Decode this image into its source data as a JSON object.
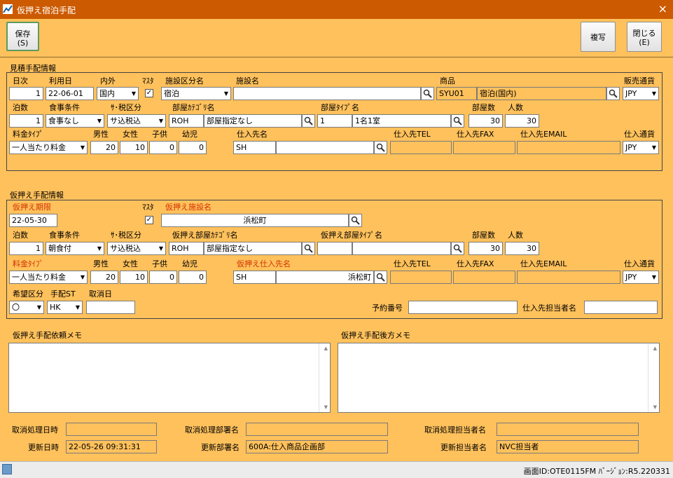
{
  "window": {
    "title": "仮押え宿泊手配",
    "close": "×"
  },
  "toolbar": {
    "save": "保存",
    "save_key": "(S)",
    "copy": "複写",
    "close": "閉じる",
    "close_key": "(E)"
  },
  "mitsumori": {
    "section_title": "見積手配情報",
    "labels": {
      "day": "日次",
      "use_date": "利用日",
      "naigai": "内外",
      "masuta": "ﾏｽﾀ",
      "facility_type": "施設区分名",
      "facility_name": "施設名",
      "product": "商品",
      "sales_currency": "販売通貨",
      "nights": "泊数",
      "meal": "食事条件",
      "service_tax": "ｻ･税区分",
      "room_category": "部屋ｶﾃｺﾞﾘ名",
      "room_type": "部屋ﾀｲﾌﾟ名",
      "rooms": "部屋数",
      "people": "人数",
      "rate_type": "料金ﾀｲﾌﾟ",
      "male": "男性",
      "female": "女性",
      "child": "子供",
      "infant": "幼児",
      "supplier": "仕入先名",
      "supplier_tel": "仕入先TEL",
      "supplier_fax": "仕入先FAX",
      "supplier_email": "仕入先EMAIL",
      "purchase_currency": "仕入通貨"
    },
    "values": {
      "day": "1",
      "use_date": "22-06-01",
      "naigai": "国内",
      "masuta_checked": "✓",
      "facility_type": "宿泊",
      "facility_name": "",
      "product_code": "SYU01",
      "product_name": "宿泊(国内)",
      "sales_currency": "JPY",
      "nights": "1",
      "meal": "食事なし",
      "service_tax": "サ込税込",
      "room_category_code": "ROH",
      "room_category_name": "部屋指定なし",
      "room_type_code": "1",
      "room_type_name": "1名1室",
      "rooms": "30",
      "people": "30",
      "rate_type": "一人当たり料金",
      "male": "20",
      "female": "10",
      "child": "0",
      "infant": "0",
      "supplier_code": "SH",
      "supplier_name": "",
      "supplier_tel": "",
      "supplier_fax": "",
      "supplier_email": "",
      "purchase_currency": "JPY"
    }
  },
  "kariosae": {
    "section_title": "仮押え手配情報",
    "labels": {
      "deadline": "仮押え期限",
      "masuta": "ﾏｽﾀ",
      "facility_name": "仮押え施設名",
      "nights": "泊数",
      "meal": "食事条件",
      "service_tax": "ｻ･税区分",
      "room_category": "仮押え部屋ｶﾃｺﾞﾘ名",
      "room_type": "仮押え部屋ﾀｲﾌﾟ名",
      "rooms": "部屋数",
      "people": "人数",
      "rate_type": "料金ﾀｲﾌﾟ",
      "male": "男性",
      "female": "女性",
      "child": "子供",
      "infant": "幼児",
      "supplier": "仮押え仕入先名",
      "supplier_tel": "仕入先TEL",
      "supplier_fax": "仕入先FAX",
      "supplier_email": "仕入先EMAIL",
      "purchase_currency": "仕入通貨",
      "request_class": "希望区分",
      "arrange_st": "手配ST",
      "cancel_date": "取消日",
      "reservation_no": "予約番号",
      "supplier_staff": "仕入先担当者名"
    },
    "values": {
      "deadline": "22-05-30",
      "masuta_checked": "✓",
      "facility_name": "浜松町",
      "nights": "1",
      "meal": "朝食付",
      "service_tax": "サ込税込",
      "room_category_code": "ROH",
      "room_category_name": "部屋指定なし",
      "room_type_code": "",
      "room_type_name": "",
      "rooms": "30",
      "people": "30",
      "rate_type": "一人当たり料金",
      "male": "20",
      "female": "10",
      "child": "0",
      "infant": "0",
      "supplier_code": "SH",
      "supplier_name": "浜松町",
      "supplier_tel": "",
      "supplier_fax": "",
      "supplier_email": "",
      "purchase_currency": "JPY",
      "request_class": "〇",
      "arrange_st": "HK",
      "cancel_date": "",
      "reservation_no": "",
      "supplier_staff": ""
    }
  },
  "memos": {
    "request_memo": "仮押え手配依頼メモ",
    "after_memo": "仮押え手配後方メモ"
  },
  "footer": {
    "cancel_datetime_label": "取消処理日時",
    "cancel_datetime": "",
    "cancel_dept_label": "取消処理部署名",
    "cancel_dept": "",
    "cancel_staff_label": "取消処理担当者名",
    "cancel_staff": "",
    "update_datetime_label": "更新日時",
    "update_datetime": "22-05-26 09:31:31",
    "update_dept_label": "更新部署名",
    "update_dept": "600A:仕入商品企画部",
    "update_staff_label": "更新担当者名",
    "update_staff": "NVC担当者"
  },
  "statusbar": {
    "text": "画面ID:OTE0115FM ﾊﾞｰｼﾞｮﾝ:R5.220331"
  }
}
